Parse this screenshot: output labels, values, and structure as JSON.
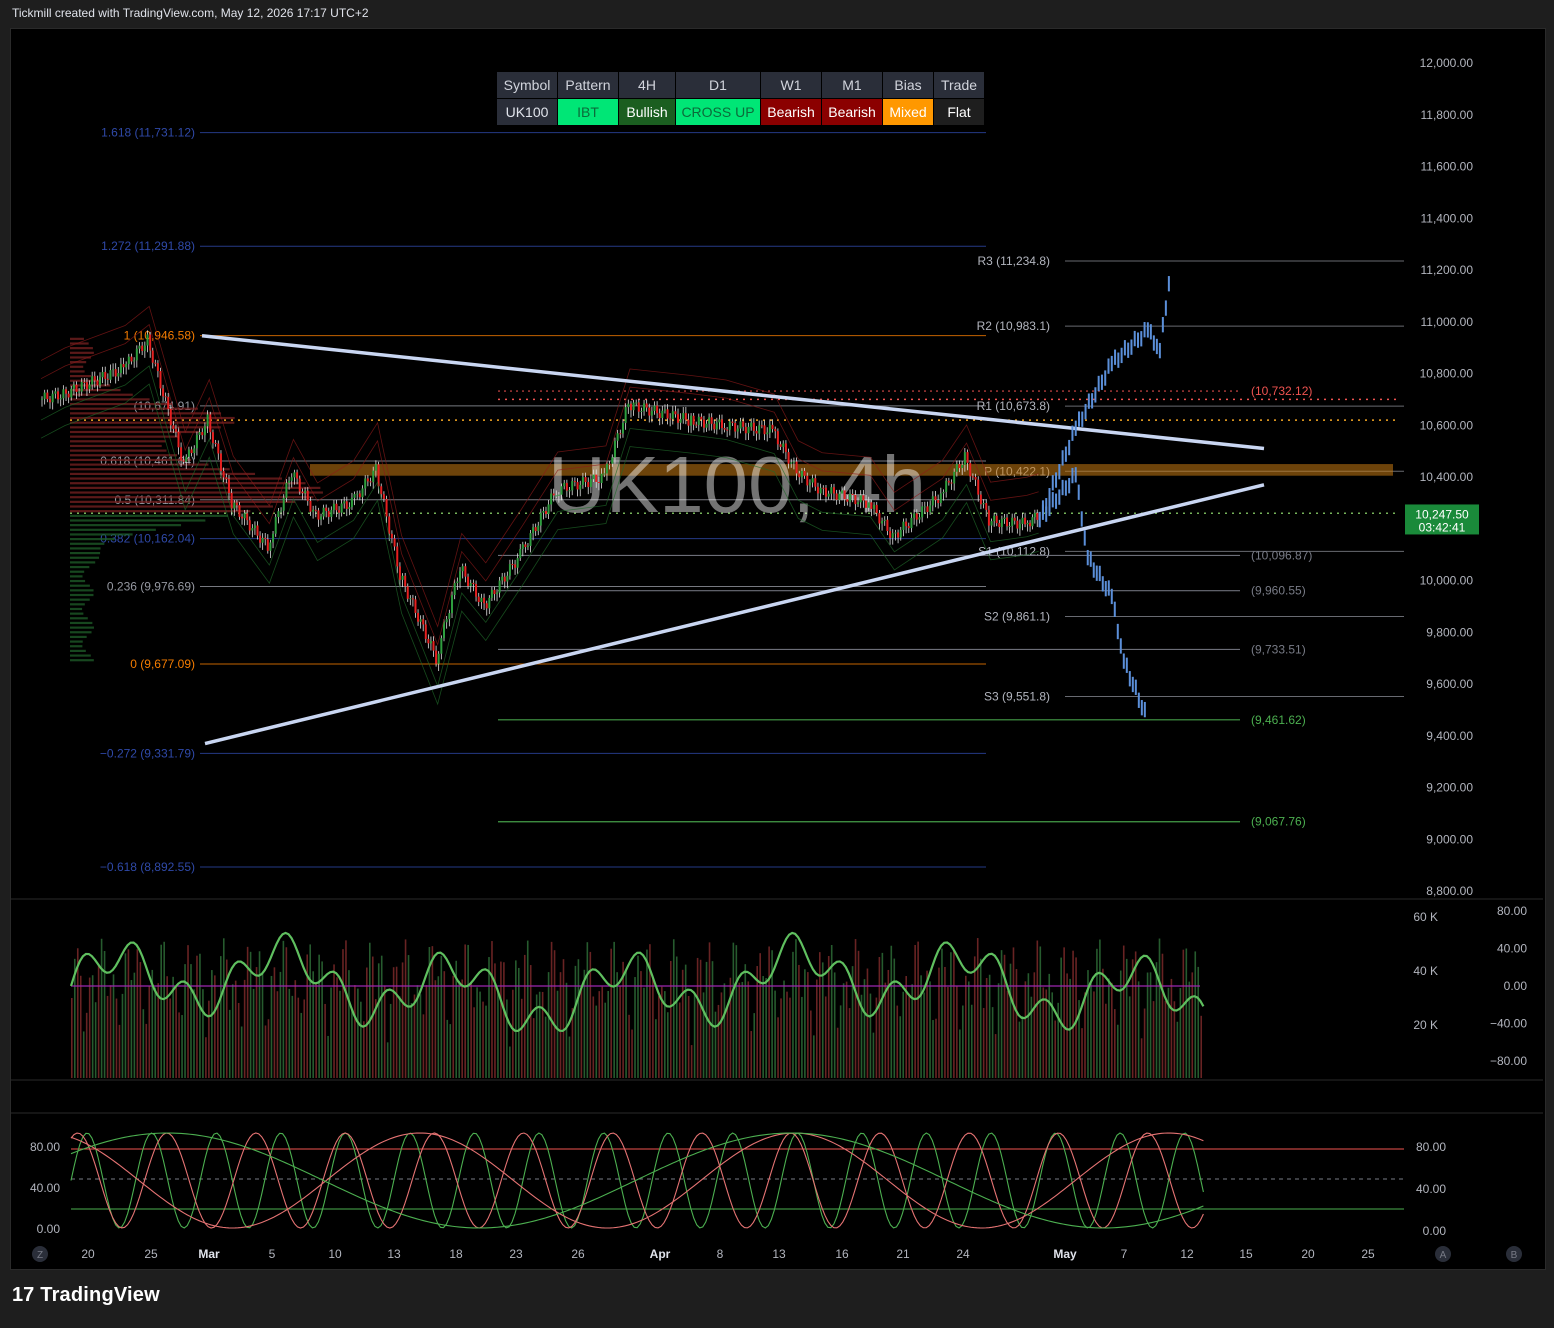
{
  "header": {
    "credit": "Tickmill created with TradingView.com, May 12, 2026 17:17 UTC+2"
  },
  "footer": {
    "brand": "TradingView"
  },
  "watermark": "UK100, 4h",
  "pattern_table": {
    "headers": [
      "Symbol",
      "Pattern",
      "4H",
      "D1",
      "W1",
      "M1",
      "Bias",
      "Trade"
    ],
    "cells": [
      {
        "text": "UK100",
        "bg": "#2a2e39",
        "fg": "#e0e3eb"
      },
      {
        "text": "IBT",
        "bg": "#00e676",
        "fg": "#0b6b3a"
      },
      {
        "text": "Bullish",
        "bg": "#1b5e20",
        "fg": "#ffffff"
      },
      {
        "text": "CROSS UP",
        "bg": "#00e676",
        "fg": "#0b6b3a"
      },
      {
        "text": "Bearish",
        "bg": "#8b0000",
        "fg": "#ffffff"
      },
      {
        "text": "Bearish",
        "bg": "#8b0000",
        "fg": "#ffffff"
      },
      {
        "text": "Mixed",
        "bg": "#ff9800",
        "fg": "#ffffff"
      },
      {
        "text": "Flat",
        "bg": "#1e1e1e",
        "fg": "#ffffff"
      }
    ]
  },
  "price_axis": {
    "ticks": [
      "12,000.00",
      "11,800.00",
      "11,600.00",
      "11,400.00",
      "11,200.00",
      "11,000.00",
      "10,800.00",
      "10,600.00",
      "10,400.00",
      "10,200.00",
      "10,000.00",
      "9,800.00",
      "9,600.00",
      "9,400.00",
      "9,200.00",
      "9,000.00",
      "8,800.00"
    ],
    "last_price": "10,247.50",
    "countdown": "03:42:41"
  },
  "volume_axis": [
    "60 K",
    "40 K",
    "20 K"
  ],
  "oscillator_axis": [
    "80.00",
    "40.00",
    "0.00",
    "−40.00",
    "−80.00"
  ],
  "stoch_axis_left": [
    "80.00",
    "40.00",
    "0.00"
  ],
  "stoch_axis_right": [
    "80.00",
    "40.00",
    "0.00"
  ],
  "time_axis": [
    "20",
    "25",
    "Mar",
    "5",
    "10",
    "13",
    "18",
    "23",
    "26",
    "Apr",
    "8",
    "13",
    "16",
    "21",
    "24",
    "May",
    "7",
    "12",
    "15",
    "20",
    "25"
  ],
  "axis_buttons": {
    "left": "Z",
    "right_a": "A",
    "right_b": "B"
  },
  "fib_levels": [
    {
      "label": "1.618 (11,731.12)",
      "price": 11731.12,
      "color": "#2f49a8"
    },
    {
      "label": "1.272 (11,291.88)",
      "price": 11291.88,
      "color": "#2f49a8"
    },
    {
      "label": "1 (10,946.58)",
      "price": 10946.58,
      "color": "#f57c00"
    },
    {
      "label": "(10,674.91)",
      "price": 10674.91,
      "color": "#9598a1"
    },
    {
      "label": "0.618 (10,461.64)",
      "price": 10461.64,
      "color": "#9598a1"
    },
    {
      "label": "0.5 (10,311.84)",
      "price": 10311.84,
      "color": "#9598a1"
    },
    {
      "label": "0.382 (10,162.04)",
      "price": 10162.04,
      "color": "#2f49a8"
    },
    {
      "label": "0.236 (9,976.69)",
      "price": 9976.69,
      "color": "#9598a1"
    },
    {
      "label": "0 (9,677.09)",
      "price": 9677.09,
      "color": "#f57c00"
    },
    {
      "label": "−0.272 (9,331.79)",
      "price": 9331.79,
      "color": "#2f49a8"
    },
    {
      "label": "−0.618 (8,892.55)",
      "price": 8892.55,
      "color": "#2f49a8"
    }
  ],
  "pivots": [
    {
      "label": "R3 (11,234.8)",
      "price": 11234.8
    },
    {
      "label": "R2 (10,983.1)",
      "price": 10983.1
    },
    {
      "label": "R1 (10,673.8)",
      "price": 10673.8
    },
    {
      "label": "P (10,422.1)",
      "price": 10422.1
    },
    {
      "label": "S1 (10,112.8)",
      "price": 10112.8
    },
    {
      "label": "S2 (9,861.1)",
      "price": 9861.1
    },
    {
      "label": "S3 (9,551.8)",
      "price": 9551.8
    }
  ],
  "projection_levels": [
    {
      "label": "(10,732.12)",
      "price": 10732.12,
      "color": "#ef5350"
    },
    {
      "label": "(10,096.87)",
      "price": 10096.87,
      "color": "#787b86"
    },
    {
      "label": "(9,960.55)",
      "price": 9960.55,
      "color": "#787b86"
    },
    {
      "label": "(9,733.51)",
      "price": 9733.51,
      "color": "#787b86"
    },
    {
      "label": "(9,461.62)",
      "price": 9461.62,
      "color": "#4caf50"
    },
    {
      "label": "(9,067.76)",
      "price": 9067.76,
      "color": "#4caf50"
    }
  ],
  "chart_data": {
    "type": "candlestick",
    "symbol": "UK100",
    "timeframe": "4h",
    "ylim": [
      8750,
      12000
    ],
    "last_price": 10247.5,
    "trendlines": [
      {
        "from": [
          "Feb 27",
          10946
        ],
        "to": [
          "May 15",
          10510
        ],
        "desc": "upper descending"
      },
      {
        "from": [
          "Feb 27",
          9370
        ],
        "to": [
          "May 15",
          10370
        ],
        "desc": "lower ascending"
      }
    ],
    "price_path_approx": [
      {
        "t": "Feb 18",
        "v": 10700
      },
      {
        "t": "Feb 20",
        "v": 10720
      },
      {
        "t": "Feb 25",
        "v": 10820
      },
      {
        "t": "Feb 27",
        "v": 10930
      },
      {
        "t": "Mar 2",
        "v": 10450
      },
      {
        "t": "Mar 4",
        "v": 10620
      },
      {
        "t": "Mar 6",
        "v": 10300
      },
      {
        "t": "Mar 9",
        "v": 10130
      },
      {
        "t": "Mar 11",
        "v": 10420
      },
      {
        "t": "Mar 13",
        "v": 10250
      },
      {
        "t": "Mar 16",
        "v": 10300
      },
      {
        "t": "Mar 18",
        "v": 10430
      },
      {
        "t": "Mar 20",
        "v": 10020
      },
      {
        "t": "Mar 23",
        "v": 9700
      },
      {
        "t": "Mar 25",
        "v": 10050
      },
      {
        "t": "Mar 27",
        "v": 9900
      },
      {
        "t": "Mar 30",
        "v": 10100
      },
      {
        "t": "Apr 2",
        "v": 10350
      },
      {
        "t": "Apr 6",
        "v": 10400
      },
      {
        "t": "Apr 8",
        "v": 10680
      },
      {
        "t": "Apr 13",
        "v": 10620
      },
      {
        "t": "Apr 16",
        "v": 10600
      },
      {
        "t": "Apr 20",
        "v": 10580
      },
      {
        "t": "Apr 22",
        "v": 10420
      },
      {
        "t": "Apr 24",
        "v": 10350
      },
      {
        "t": "Apr 28",
        "v": 10300
      },
      {
        "t": "Apr 30",
        "v": 10170
      },
      {
        "t": "May 4",
        "v": 10330
      },
      {
        "t": "May 6",
        "v": 10480
      },
      {
        "t": "May 8",
        "v": 10230
      },
      {
        "t": "May 11",
        "v": 10220
      },
      {
        "t": "May 12",
        "v": 10247.5
      }
    ],
    "projection_bull": [
      {
        "t": "May 12",
        "v": 10247
      },
      {
        "t": "May 15",
        "v": 10600
      },
      {
        "t": "May 18",
        "v": 10850
      },
      {
        "t": "May 21",
        "v": 10980
      },
      {
        "t": "May 22",
        "v": 10900
      },
      {
        "t": "May 23",
        "v": 11250
      }
    ],
    "projection_bear": [
      {
        "t": "May 12",
        "v": 10247
      },
      {
        "t": "May 15",
        "v": 10420
      },
      {
        "t": "May 16",
        "v": 10100
      },
      {
        "t": "May 18",
        "v": 9950
      },
      {
        "t": "May 19",
        "v": 9700
      },
      {
        "t": "May 21",
        "v": 9470
      }
    ]
  }
}
